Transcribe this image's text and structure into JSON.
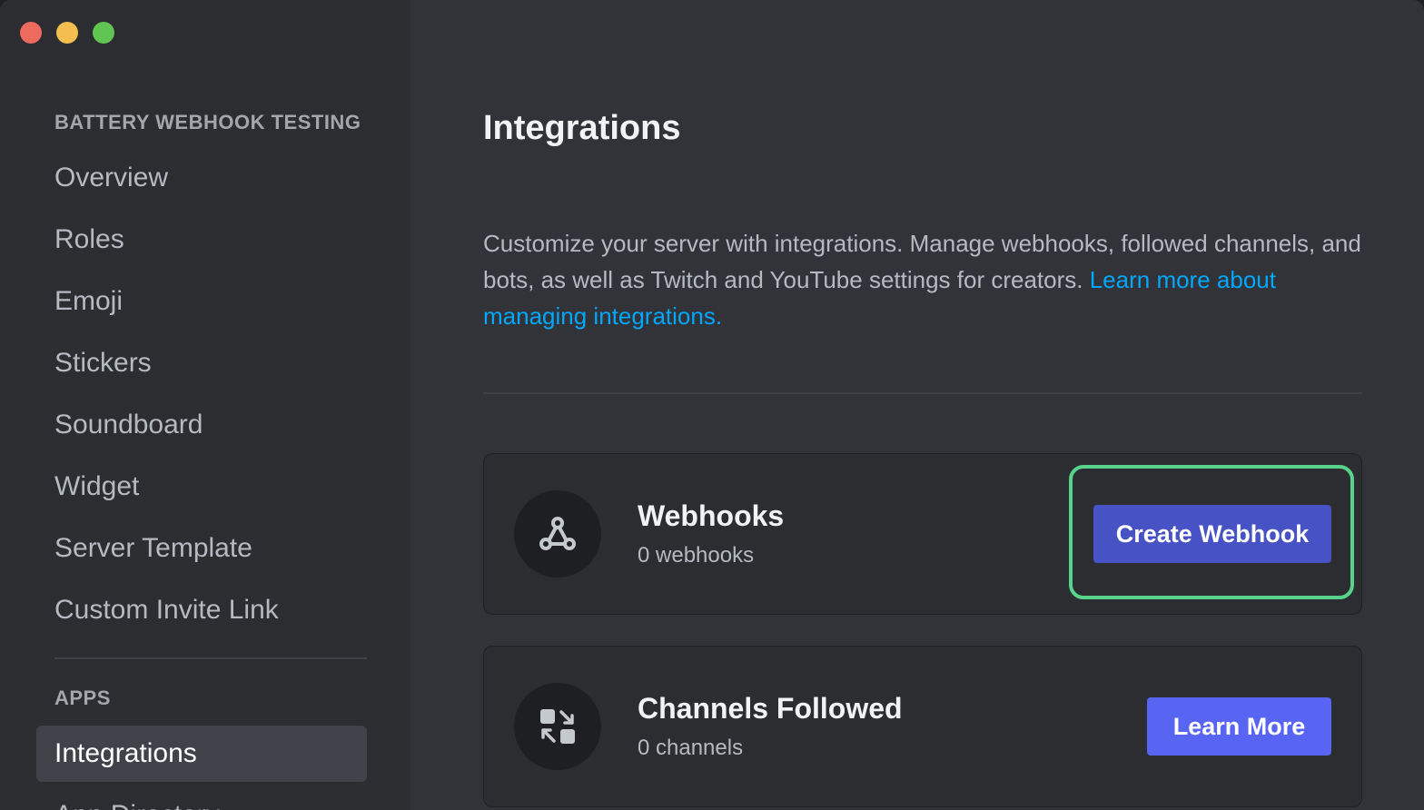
{
  "sidebar": {
    "server_header": "BATTERY WEBHOOK TESTING",
    "items": [
      {
        "label": "Overview"
      },
      {
        "label": "Roles"
      },
      {
        "label": "Emoji"
      },
      {
        "label": "Stickers"
      },
      {
        "label": "Soundboard"
      },
      {
        "label": "Widget"
      },
      {
        "label": "Server Template"
      },
      {
        "label": "Custom Invite Link"
      }
    ],
    "apps_header": "APPS",
    "apps_items": [
      {
        "label": "Integrations",
        "active": true
      },
      {
        "label": "App Directory"
      }
    ]
  },
  "main": {
    "title": "Integrations",
    "description": "Customize your server with integrations. Manage webhooks, followed channels, and bots, as well as Twitch and YouTube settings for creators.",
    "learn_more_link": "Learn more about managing integrations.",
    "cards": [
      {
        "title": "Webhooks",
        "subtitle": "0 webhooks",
        "button": "Create Webhook",
        "icon": "webhook-icon"
      },
      {
        "title": "Channels Followed",
        "subtitle": "0 channels",
        "button": "Learn More",
        "icon": "channels-followed-icon"
      }
    ]
  },
  "colors": {
    "accent": "#5865f2",
    "link": "#00a8fc",
    "highlight": "#57d38c"
  }
}
